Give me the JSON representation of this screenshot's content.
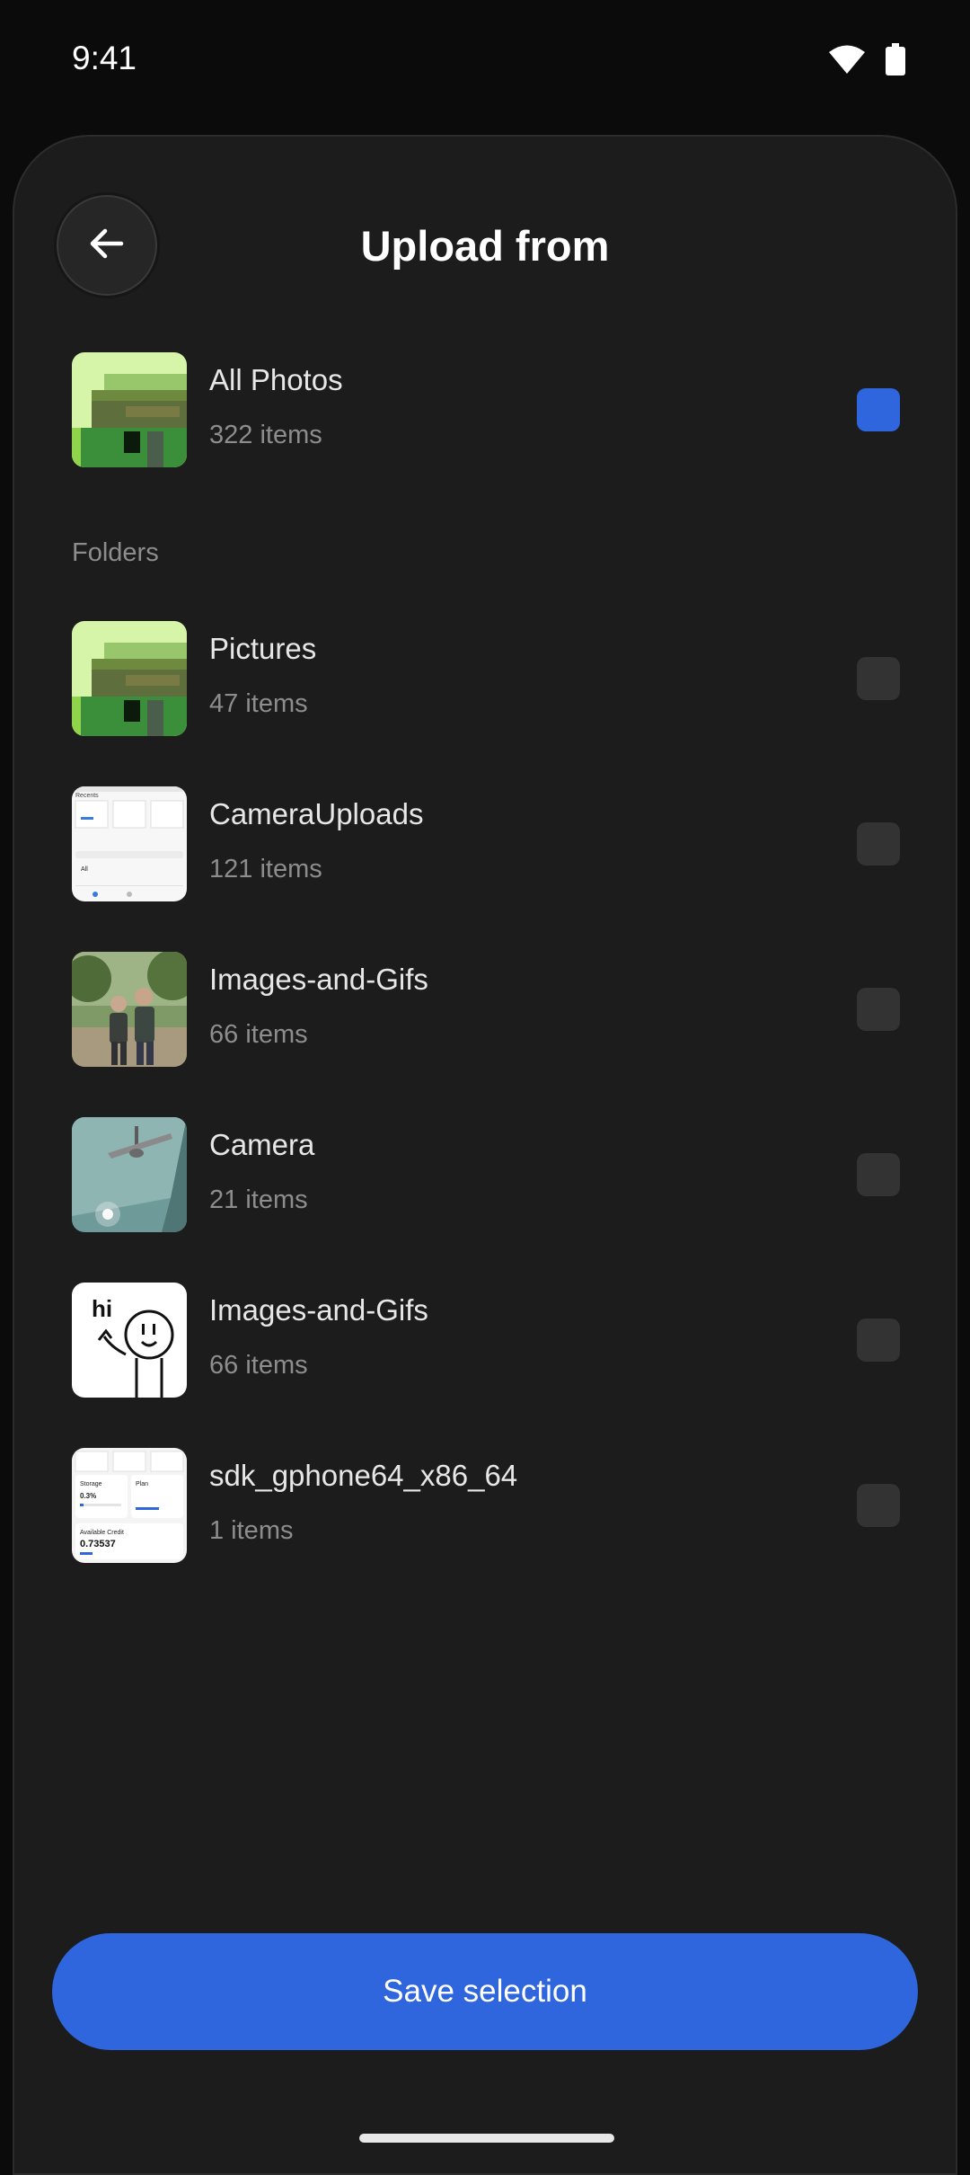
{
  "status_bar": {
    "time": "9:41",
    "icons": [
      "wifi-icon",
      "battery-icon"
    ]
  },
  "header": {
    "title": "Upload from",
    "back_icon": "arrow-left-icon"
  },
  "all_photos": {
    "name": "All Photos",
    "count": "322 items",
    "checked": true
  },
  "folders_label": "Folders",
  "folders": [
    {
      "name": "Pictures",
      "count": "47 items",
      "checked": false
    },
    {
      "name": "CameraUploads",
      "count": "121 items",
      "checked": false
    },
    {
      "name": "Images-and-Gifs",
      "count": "66 items",
      "checked": false
    },
    {
      "name": "Camera",
      "count": "21 items",
      "checked": false
    },
    {
      "name": "Images-and-Gifs",
      "count": "66 items",
      "checked": false
    },
    {
      "name": "sdk_gphone64_x86_64",
      "count": "1 items",
      "checked": false
    }
  ],
  "thumbnail_text": {
    "camera_uploads": [
      "Recents",
      "All"
    ],
    "hi_sticker": "hi",
    "sdk_screenshot": [
      "Storage",
      "0.3%",
      "Plan",
      "Available Credit",
      "0.73537"
    ]
  },
  "save_button": "Save selection",
  "colors": {
    "accent": "#2f66de",
    "sheet": "#1c1c1c",
    "background": "#0b0b0b"
  }
}
